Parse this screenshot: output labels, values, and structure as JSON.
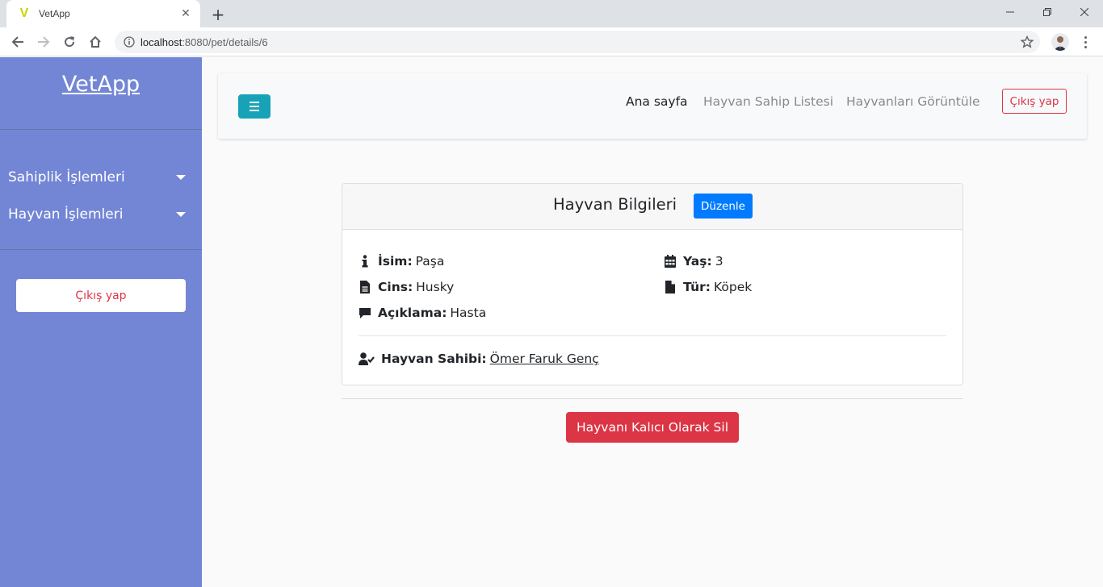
{
  "browser": {
    "tab_title": "VetApp",
    "tab_favicon": "V",
    "url_host": "localhost",
    "url_rest": ":8080/pet/details/6"
  },
  "sidebar": {
    "brand": "VetApp",
    "items": [
      {
        "label": "Sahiplik İşlemleri"
      },
      {
        "label": "Hayvan İşlemleri"
      }
    ],
    "logout_label": "Çıkış yap"
  },
  "navbar": {
    "links": [
      {
        "label": "Ana sayfa",
        "active": true
      },
      {
        "label": "Hayvan Sahip Listesi",
        "active": false
      },
      {
        "label": "Hayvanları Görüntüle",
        "active": false
      }
    ],
    "logout_label": "Çıkış yap"
  },
  "card": {
    "title": "Hayvan Bilgileri",
    "edit_label": "Düzenle",
    "fields": {
      "name": {
        "label": "İsim:",
        "value": "Paşa",
        "icon": "info-icon"
      },
      "breed": {
        "label": "Cins:",
        "value": "Husky",
        "icon": "file-text-icon"
      },
      "description": {
        "label": "Açıklama:",
        "value": "Hasta",
        "icon": "comment-icon"
      },
      "age": {
        "label": "Yaş:",
        "value": "3",
        "icon": "calendar-icon"
      },
      "type": {
        "label": "Tür:",
        "value": "Köpek",
        "icon": "file-icon"
      }
    },
    "owner": {
      "label": "Hayvan Sahibi:",
      "value": "Ömer Faruk Genç",
      "icon": "user-check-icon"
    }
  },
  "delete_label": "Hayvanı Kalıcı Olarak Sil",
  "colors": {
    "sidebar": "#7386d5",
    "accent_teal": "#17a2b8",
    "primary": "#007bff",
    "danger": "#dc3545"
  }
}
